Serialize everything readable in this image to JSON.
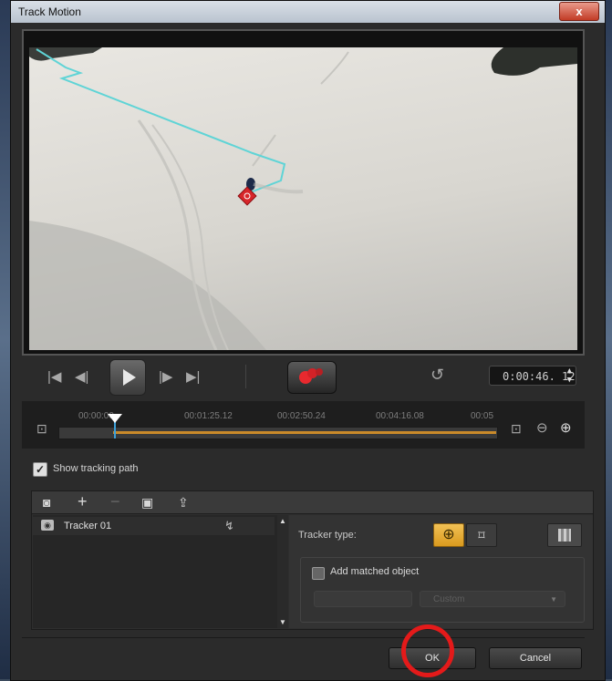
{
  "window": {
    "title": "Track Motion",
    "close_label": "x"
  },
  "playback": {
    "timecode": "0:00:46. 12",
    "icons": [
      "go-to-start-icon",
      "previous-frame-icon",
      "play-icon",
      "next-frame-icon",
      "go-to-end-icon",
      "track-motion-record-icon",
      "reset-icon"
    ]
  },
  "timeline": {
    "ticks": [
      "00:00:00",
      "00:01:25.12",
      "00:02:50.24",
      "00:04:16.08",
      "00:05"
    ]
  },
  "show_tracking_path": {
    "label": "Show tracking path",
    "checked": true
  },
  "tracker_toolbar": {
    "icons": [
      "tracker-eye-icon",
      "add-tracker-icon",
      "remove-tracker-icon",
      "rename-tracker-icon",
      "export-tracker-icon"
    ]
  },
  "trackers": [
    {
      "label": "Tracker 01"
    }
  ],
  "tracker_props": {
    "tracker_type_label": "Tracker type:",
    "add_matched_label": "Add matched object",
    "add_matched_checked": false,
    "position_value": "Custom"
  },
  "footer": {
    "ok_label": "OK",
    "cancel_label": "Cancel"
  },
  "colors": {
    "accent": "#d99a1e",
    "record": "#e8292e",
    "path": "#5fd4d6",
    "annotation": "#e41a1a"
  }
}
